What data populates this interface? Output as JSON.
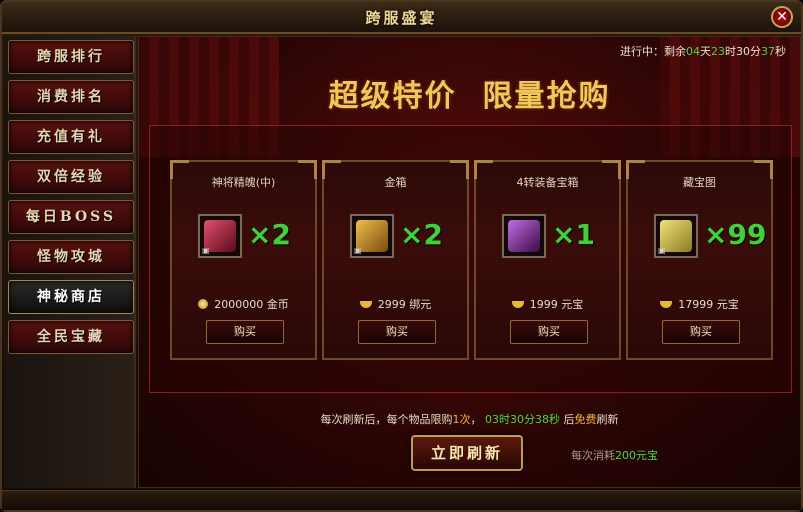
{
  "window": {
    "title": "跨服盛宴",
    "close_label": "✕"
  },
  "sidebar": {
    "items": [
      {
        "label": "跨服排行",
        "active": false
      },
      {
        "label": "消费排名",
        "active": false
      },
      {
        "label": "充值有礼",
        "active": false
      },
      {
        "label": "双倍经验",
        "active": false
      },
      {
        "label": "每日BOSS",
        "active": false
      },
      {
        "label": "怪物攻城",
        "active": false
      },
      {
        "label": "神秘商店",
        "active": true
      },
      {
        "label": "全民宝藏",
        "active": false
      }
    ]
  },
  "timer": {
    "prefix": "进行中：剩余",
    "days": "04",
    "d_unit": "天",
    "hours": "23",
    "h_unit": "时",
    "minutes": "30",
    "m_unit": "分",
    "seconds": "37",
    "s_unit": "秒"
  },
  "banner": {
    "left": "超级特价",
    "right": "限量抢购"
  },
  "goods": [
    {
      "name": "神将精魄(中)",
      "qty": "×2",
      "price": "2000000",
      "currency": "金币",
      "currency_icon": "gold-coin-icon",
      "buy_label": "购买",
      "item_color": "#c0304a"
    },
    {
      "name": "金箱",
      "qty": "×2",
      "price": "2999",
      "currency": "绑元",
      "currency_icon": "bound-ingot-icon",
      "buy_label": "购买",
      "item_color": "#c98a24"
    },
    {
      "name": "4转装备宝箱",
      "qty": "×1",
      "price": "1999",
      "currency": "元宝",
      "currency_icon": "ingot-icon",
      "buy_label": "购买",
      "item_color": "#8a3aa8"
    },
    {
      "name": "藏宝图",
      "qty": "×99",
      "price": "17999",
      "currency": "元宝",
      "currency_icon": "ingot-icon",
      "buy_label": "购买",
      "item_color": "#d9c24a"
    }
  ],
  "note": {
    "p1": "每次刷新后，每个物品限购",
    "limit": "1次",
    "p2": "，",
    "time": "03时30分38秒",
    "p3": "后",
    "free": "免费",
    "p4": "刷新"
  },
  "refresh": {
    "label": "立即刷新"
  },
  "cost": {
    "p1": "每次消耗",
    "amount": "200元宝"
  },
  "colors": {
    "accent_gold": "#f3c65a",
    "highlight_green": "#45d848",
    "panel_red": "#8d1d1d"
  }
}
